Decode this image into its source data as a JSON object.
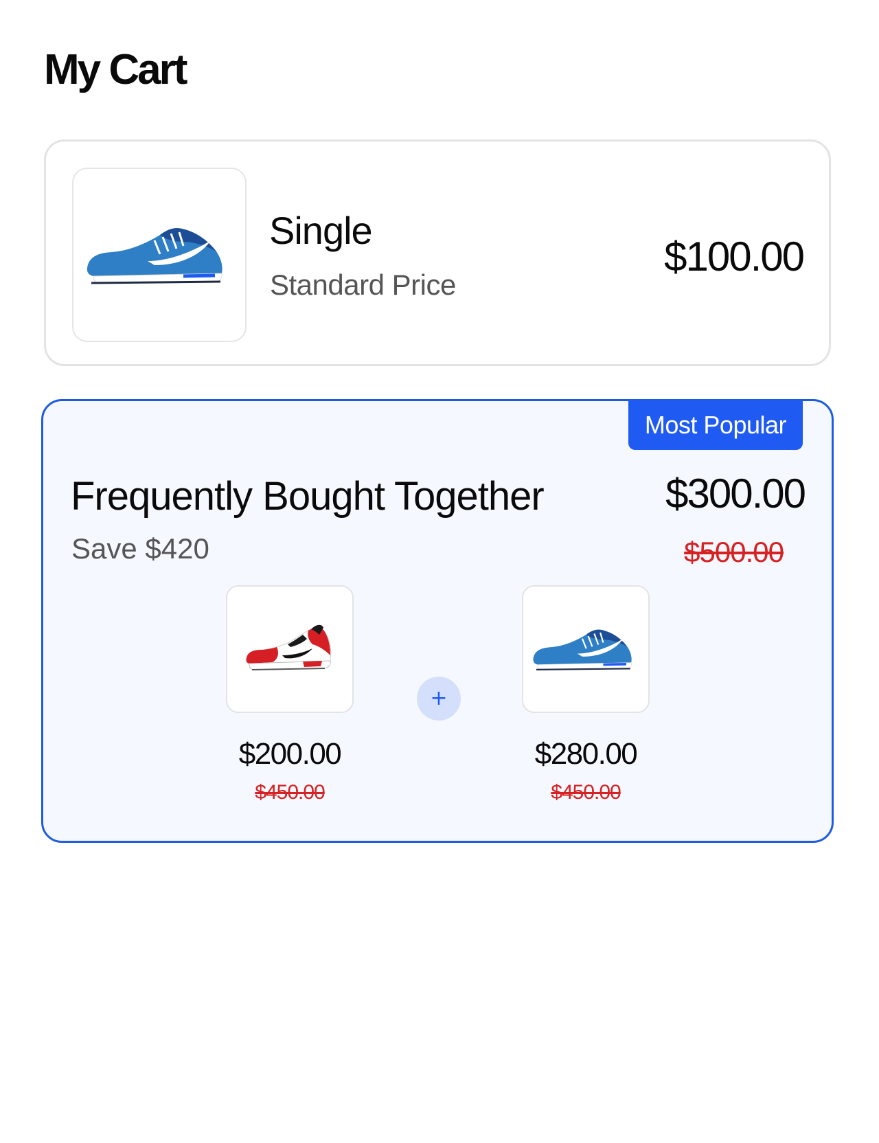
{
  "page": {
    "title": "My Cart"
  },
  "single": {
    "name": "Single",
    "subtitle": "Standard Price",
    "price": "$100.00",
    "image_icon": "blue-running-shoe"
  },
  "bundle": {
    "badge": "Most Popular",
    "title": "Frequently Bought Together",
    "savings": "Save $420",
    "price": "$300.00",
    "original_price": "$500.00",
    "plus_symbol": "+",
    "items": [
      {
        "image_icon": "red-white-sneaker",
        "price": "$200.00",
        "original_price": "$450.00"
      },
      {
        "image_icon": "blue-running-shoe",
        "price": "$280.00",
        "original_price": "$450.00"
      }
    ]
  },
  "colors": {
    "accent": "#1f5bf2",
    "strike_red": "#d62222",
    "bundle_bg": "#f5f8ff",
    "shoe_blue": "#2f7fc6",
    "shoe_red": "#d61f24"
  }
}
